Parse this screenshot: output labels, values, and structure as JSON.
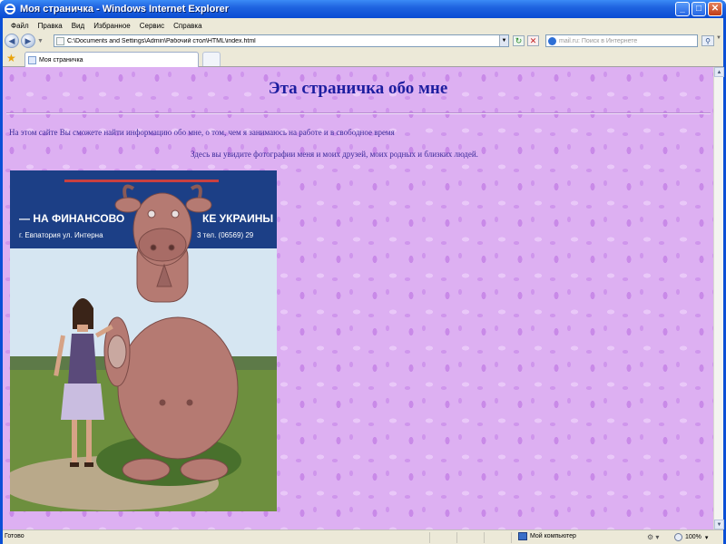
{
  "window": {
    "title": "Моя страничка - Windows Internet Explorer",
    "controls": {
      "minimize": "_",
      "maximize": "□",
      "close": "✕"
    }
  },
  "menu": {
    "items": [
      "Файл",
      "Правка",
      "Вид",
      "Избранное",
      "Сервис",
      "Справка"
    ]
  },
  "nav": {
    "back_icon": "back-arrow-icon",
    "forward_icon": "forward-arrow-icon",
    "address": "C:\\Documents and Settings\\Admin\\Рабочий стол\\HTML\\index.html",
    "search_placeholder": "mail.ru: Поиск в Интернете"
  },
  "tabs": [
    {
      "label": "Моя страничка",
      "active": true
    }
  ],
  "page": {
    "heading": "Эта страничка обо мне",
    "intro": "На этом сайте Вы сможете найти информацию обо мне, о том, чем я занимаюсь на работе и в свободное время",
    "photos_caption": "Здесь вы увидите фотографии меня и моих друзей, моих родных и близких людей.",
    "photo": {
      "sign_line1": "— НА ФИНАНСОВО",
      "sign_line1b": "КЕ УКРАИНЫ -",
      "sign_line2": "г. Евпатория ул. Интерна",
      "sign_line2b": "3 тел. (06569) 29"
    }
  },
  "status": {
    "text": "Готово",
    "zone": "Мой компьютер",
    "zoom": "100%"
  },
  "colors": {
    "page_bg": "#ddb0f2",
    "heading": "#1e1ea0",
    "text": "#3a2a9a",
    "titlebar": "#1f64e0"
  }
}
